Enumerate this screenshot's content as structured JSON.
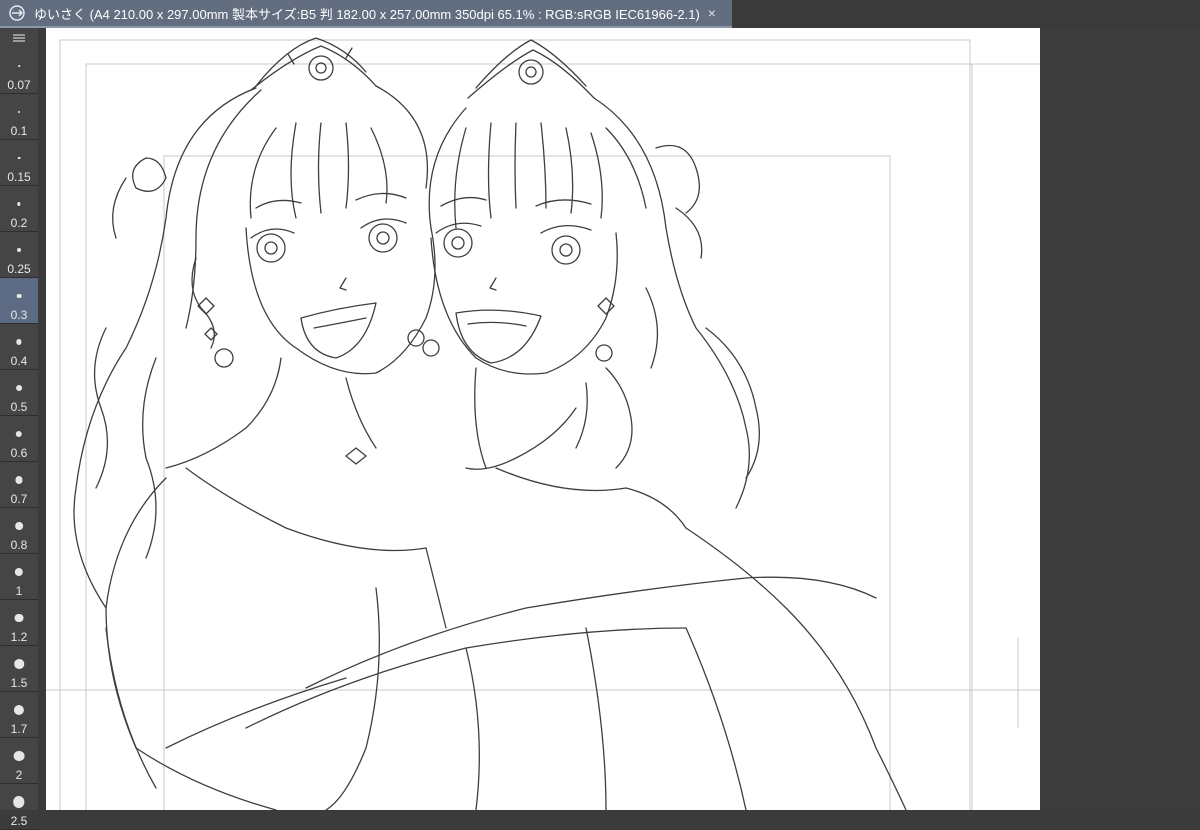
{
  "document_tab": {
    "title": "ゆいさく (A4 210.00 x 297.00mm 製本サイズ:B5 判 182.00 x 257.00mm 350dpi 65.1% : RGB:sRGB IEC61966-2.1)",
    "close_glyph": "×",
    "link_icon": "link-icon"
  },
  "brush_size_panel": {
    "handle_icon": "menu-handle-icon",
    "selected": "0.3",
    "sizes": [
      {
        "label": "0.07"
      },
      {
        "label": "0.1"
      },
      {
        "label": "0.15"
      },
      {
        "label": "0.2"
      },
      {
        "label": "0.25"
      },
      {
        "label": "0.3"
      },
      {
        "label": "0.4"
      },
      {
        "label": "0.5"
      },
      {
        "label": "0.6"
      },
      {
        "label": "0.7"
      },
      {
        "label": "0.8"
      },
      {
        "label": "1"
      },
      {
        "label": "1.2"
      },
      {
        "label": "1.5"
      },
      {
        "label": "1.7"
      },
      {
        "label": "2"
      },
      {
        "label": "2.5"
      }
    ]
  },
  "canvas": {
    "content": "pencil sketch of two smiling girls wearing tiaras, hugging",
    "background_color": "#ffffff",
    "guide_color": "#c8c8c8",
    "sketch_color": "#2a2a2a"
  },
  "colors": {
    "tab_active": "#626d80",
    "panel_bg": "#454545",
    "selected_item": "#5d6a84",
    "app_bg": "#3b3b3b"
  }
}
